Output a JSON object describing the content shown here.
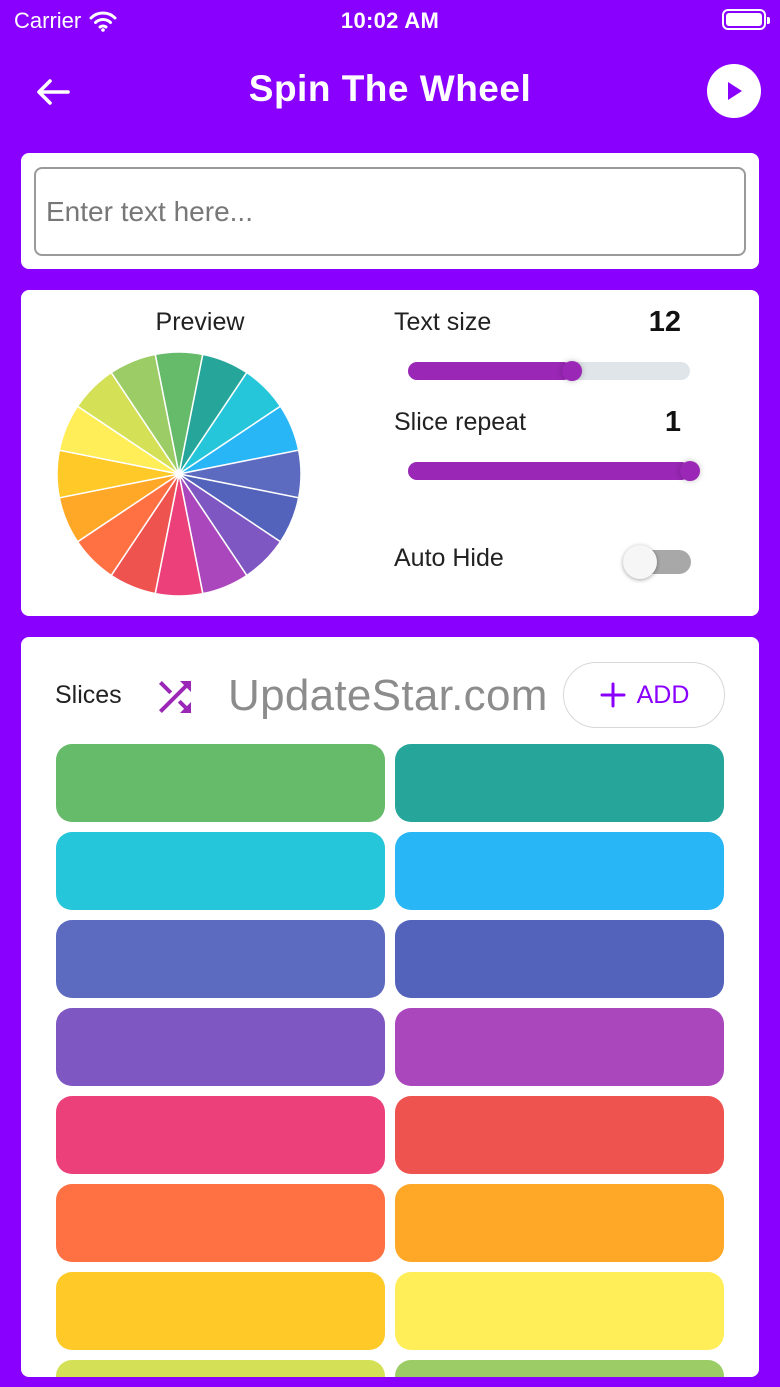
{
  "status": {
    "carrier": "Carrier",
    "time": "10:02 AM"
  },
  "header": {
    "title": "Spin The Wheel",
    "back_icon": "arrow-left-icon",
    "play_icon": "play-icon"
  },
  "input": {
    "placeholder": "Enter text here...",
    "value": ""
  },
  "preview": {
    "label": "Preview"
  },
  "settings": {
    "text_size_label": "Text size",
    "text_size_value": "12",
    "text_size_fraction": 0.58,
    "slice_repeat_label": "Slice repeat",
    "slice_repeat_value": "1",
    "slice_repeat_fraction": 1.0,
    "auto_hide_label": "Auto Hide",
    "auto_hide_on": false
  },
  "slices_section": {
    "label": "Slices",
    "shuffle_icon": "shuffle-icon",
    "watermark": "UpdateStar.com",
    "add_label": "ADD"
  },
  "slice_colors": [
    "#66BB6A",
    "#26A69A",
    "#26C6DA",
    "#29B6F6",
    "#5C6BC0",
    "#5363BB",
    "#7E57C2",
    "#AB47BC",
    "#EC407A",
    "#EF5350",
    "#FF7043",
    "#FFA726",
    "#FFCA28",
    "#FFEE58",
    "#D4E157",
    "#9CCC65"
  ],
  "wheel_colors": [
    "#66BB6A",
    "#26A69A",
    "#26C6DA",
    "#29B6F6",
    "#5C6BC0",
    "#5363BB",
    "#7E57C2",
    "#AB47BC",
    "#EC407A",
    "#EF5350",
    "#FF7043",
    "#FFA726",
    "#FFCA28",
    "#FFEE58",
    "#D4E157",
    "#9CCC65"
  ],
  "colors": {
    "primary": "#8A00FF",
    "slider": "#9A27B6"
  }
}
